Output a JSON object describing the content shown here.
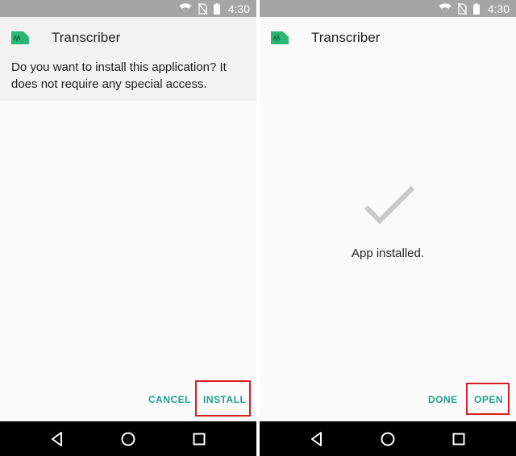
{
  "status_bar": {
    "time": "4:30"
  },
  "left_screen": {
    "app_title": "Transcriber",
    "install_prompt": "Do you want to install this application? It does not require any special access.",
    "buttons": {
      "cancel": "CANCEL",
      "install": "INSTALL"
    }
  },
  "right_screen": {
    "app_title": "Transcriber",
    "installed_message": "App installed.",
    "buttons": {
      "done": "DONE",
      "open": "OPEN"
    }
  },
  "colors": {
    "accent": "#1e9e90",
    "highlight": "#d71f26",
    "status_bar": "#a5a5a5",
    "nav_bar": "#000000",
    "app_icon": "#2bb673"
  },
  "icons": [
    "wifi-icon",
    "no-sim-icon",
    "battery-icon",
    "app-icon",
    "checkmark-icon",
    "back-icon",
    "home-icon",
    "recent-apps-icon"
  ]
}
